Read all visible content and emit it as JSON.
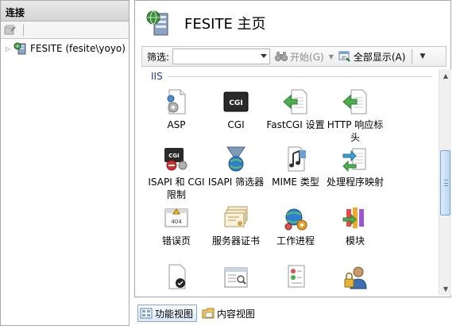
{
  "connections": {
    "header": "连接",
    "tree": [
      {
        "label": "FESITE (fesite\\yoyo)"
      }
    ]
  },
  "page": {
    "title": "FESITE 主页"
  },
  "filterbar": {
    "filter_label": "筛选:",
    "filter_value": "",
    "start_label": "开始(G)",
    "show_all_label": "全部显示(A)"
  },
  "group": {
    "name": "IIS"
  },
  "features": [
    {
      "label": "ASP",
      "icon": "asp-icon"
    },
    {
      "label": "CGI",
      "icon": "cgi-icon"
    },
    {
      "label": "FastCGI 设置",
      "icon": "fastcgi-icon"
    },
    {
      "label": "HTTP 响应标头",
      "icon": "http-headers-icon"
    },
    {
      "label": "ISAPI 和 CGI 限制",
      "icon": "isapi-cgi-restrictions-icon"
    },
    {
      "label": "ISAPI 筛选器",
      "icon": "isapi-filters-icon"
    },
    {
      "label": "MIME 类型",
      "icon": "mime-types-icon"
    },
    {
      "label": "处理程序映射",
      "icon": "handler-mappings-icon"
    },
    {
      "label": "错误页",
      "icon": "error-pages-icon"
    },
    {
      "label": "服务器证书",
      "icon": "server-certificates-icon"
    },
    {
      "label": "工作进程",
      "icon": "worker-processes-icon"
    },
    {
      "label": "模块",
      "icon": "modules-icon"
    },
    {
      "label": "",
      "icon": "default-document-icon"
    },
    {
      "label": "",
      "icon": "directory-browsing-icon"
    },
    {
      "label": "",
      "icon": "logging-icon"
    },
    {
      "label": "",
      "icon": "authentication-icon"
    }
  ],
  "bottom": {
    "features_view": "功能视图",
    "content_view": "内容视图"
  },
  "colors": {
    "group_header": "#1c3c9a",
    "scroll_thumb": "#bcd7f5"
  }
}
